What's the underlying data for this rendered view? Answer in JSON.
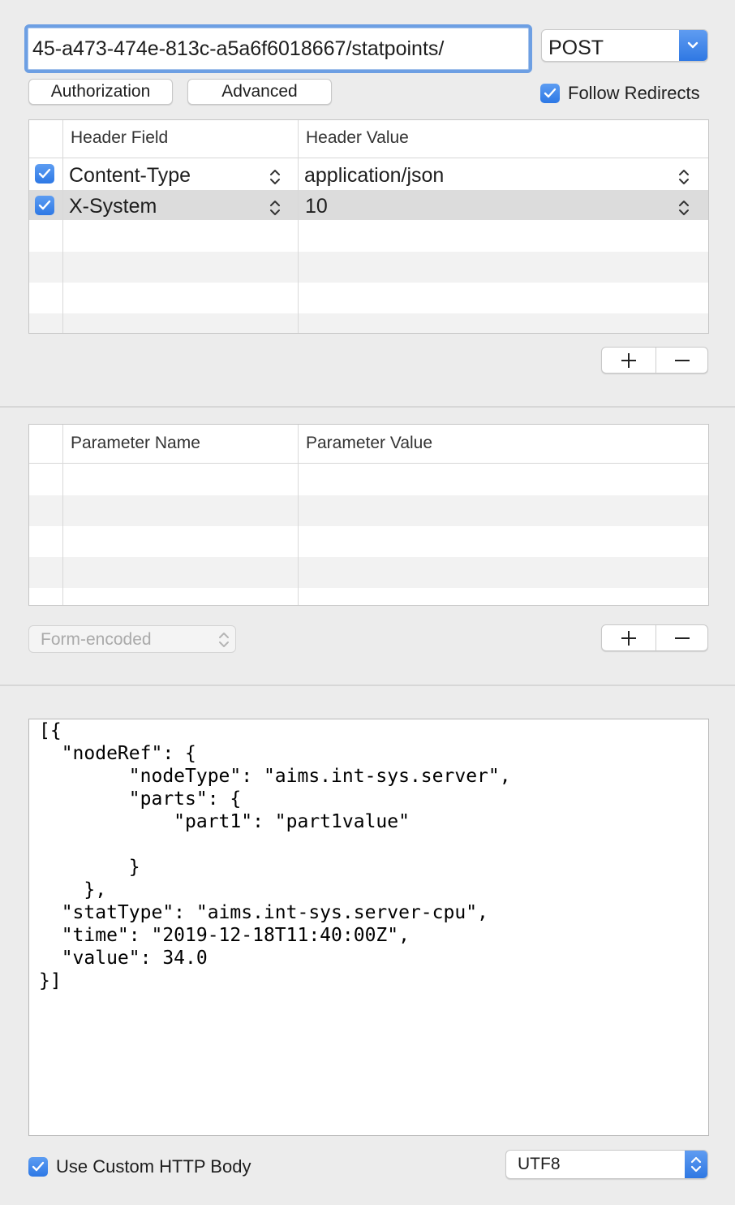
{
  "request": {
    "url": "45-a473-474e-813c-a5a6f6018667/statpoints/",
    "method": "POST"
  },
  "buttons": {
    "authorization": "Authorization",
    "advanced": "Advanced"
  },
  "options": {
    "follow_redirects": "Follow Redirects",
    "use_custom_body": "Use Custom HTTP Body"
  },
  "headers_table": {
    "col_field": "Header Field",
    "col_value": "Header Value",
    "rows": [
      {
        "enabled": true,
        "field": "Content-Type",
        "value": "application/json"
      },
      {
        "enabled": true,
        "field": "X-System",
        "value": "10"
      }
    ]
  },
  "params_table": {
    "col_name": "Parameter Name",
    "col_value": "Parameter Value"
  },
  "encoding_mode": "Form-encoded",
  "body_text": "[{\n  \"nodeRef\": {\n        \"nodeType\": \"aims.int-sys.server\",\n        \"parts\": {\n            \"part1\": \"part1value\"\n\n        }\n    },\n  \"statType\": \"aims.int-sys.server-cpu\",\n  \"time\": \"2019-12-18T11:40:00Z\",\n  \"value\": 34.0\n}]",
  "charset": "UTF8",
  "icons": {
    "checkbox": "checkmark-icon",
    "stepper": "up-down-chevron-icon",
    "add": "plus-icon",
    "remove": "minus-icon"
  }
}
